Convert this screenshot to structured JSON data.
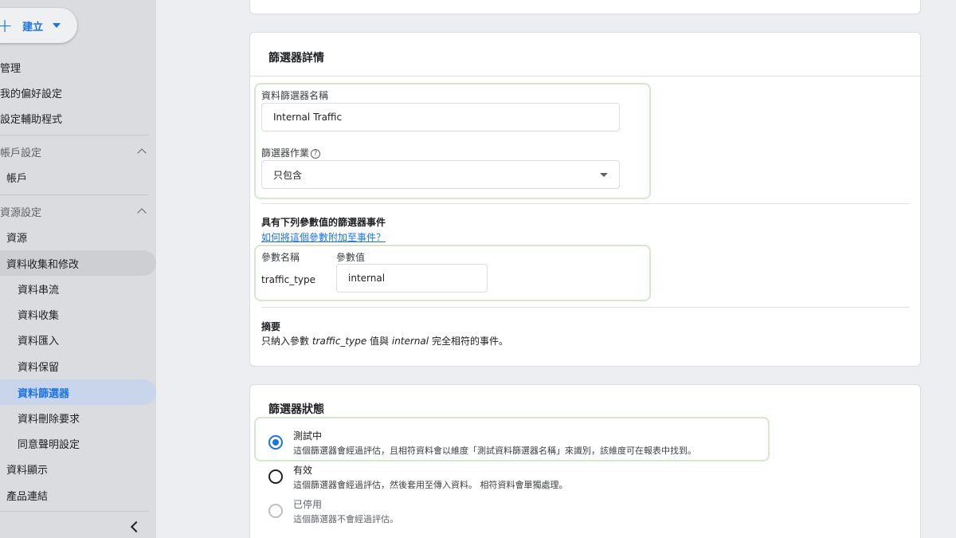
{
  "sidebar": {
    "create_label": "建立",
    "items": [
      {
        "label": "管理"
      },
      {
        "label": "我的偏好設定"
      },
      {
        "label": "設定輔助程式"
      },
      {
        "label": "帳戶設定"
      },
      {
        "label": "帳戶"
      },
      {
        "label": "資源設定"
      },
      {
        "label": "資源"
      },
      {
        "label": "資料收集和修改"
      },
      {
        "label": "資料串流"
      },
      {
        "label": "資料收集"
      },
      {
        "label": "資料匯入"
      },
      {
        "label": "資料保留"
      },
      {
        "label": "資料篩選器"
      },
      {
        "label": "資料刪除要求"
      },
      {
        "label": "同意聲明設定"
      },
      {
        "label": "資料顯示"
      },
      {
        "label": "產品連結"
      }
    ]
  },
  "details": {
    "title": "篩選器詳情",
    "name_label": "資料篩選器名稱",
    "name_value": "Internal Traffic",
    "operation_label": "篩選器作業",
    "help_glyph": "?",
    "operation_value": "只包含",
    "params_heading": "具有下列參數值的篩選器事件",
    "params_link": "如何將這個參數附加至事件？",
    "param_name_header": "參數名稱",
    "param_value_header": "參數值",
    "param_name": "traffic_type",
    "param_value": "internal",
    "summary_heading": "摘要",
    "summary_prefix": "只納入參數 ",
    "summary_param": "traffic_type",
    "summary_mid": " 值與 ",
    "summary_value": "internal",
    "summary_suffix": " 完全相符的事件。"
  },
  "status": {
    "title": "篩選器狀態",
    "options": [
      {
        "title": "測試中",
        "desc": "這個篩選器會經過評估，且相符資料會以維度「測試資料篩選器名稱」來識別，該維度可在報表中找到。",
        "checked": true
      },
      {
        "title": "有效",
        "desc": "這個篩選器會經過評估，然後套用至傳入資料。 相符資料會單獨處理。",
        "checked": false
      },
      {
        "title": "已停用",
        "desc": "這個篩選器不會經過評估。",
        "checked": false
      }
    ]
  },
  "colors": {
    "accent": "#1a73e8",
    "highlight": "#d4e8cb",
    "sidebar_bg": "#dadcdf",
    "page_bg": "#eceef1"
  }
}
